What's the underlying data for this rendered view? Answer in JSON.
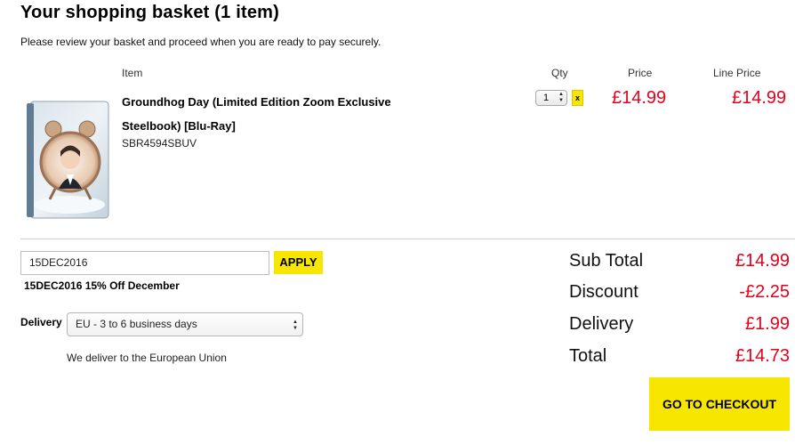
{
  "page": {
    "title": "Your shopping basket (1 item)",
    "intro": "Please review your basket and proceed when you are ready to pay securely."
  },
  "columns": {
    "item": "Item",
    "qty": "Qty",
    "price": "Price",
    "line_price": "Line Price"
  },
  "basket_item": {
    "name": "Groundhog Day (Limited Edition Zoom Exclusive Steelbook) [Blu-Ray]",
    "sku": "SBR4594SBUV",
    "qty": "1",
    "remove_label": "x",
    "price": "£14.99",
    "line_price": "£14.99"
  },
  "promo": {
    "code_value": "15DEC2016",
    "apply_label": "APPLY",
    "applied_description": "15DEC2016 15% Off December"
  },
  "delivery": {
    "label": "Delivery",
    "selected_option": "EU - 3 to 6 business days",
    "note": "We deliver to the European Union"
  },
  "summary": {
    "subtotal_label": "Sub Total",
    "subtotal_value": "£14.99",
    "discount_label": "Discount",
    "discount_value": "-£2.25",
    "delivery_label": "Delivery",
    "delivery_value": "£1.99",
    "total_label": "Total",
    "total_value": "£14.73"
  },
  "checkout": {
    "label": "GO TO CHECKOUT"
  },
  "colors": {
    "accent_yellow": "#f7e600",
    "price_red": "#e3001b"
  }
}
